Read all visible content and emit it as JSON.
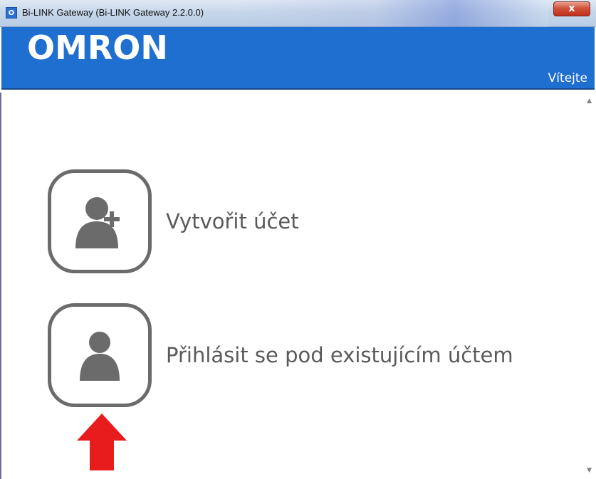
{
  "window": {
    "title": "Bi-LINK Gateway (Bi-LINK Gateway 2.2.0.0)",
    "close_label": "x"
  },
  "header": {
    "logo": "OMRON",
    "welcome": "Vítejte",
    "color": "#1e6fd0"
  },
  "options": {
    "create_account": "Vytvořit účet",
    "login_existing": "Přihlásit se pod existujícím účtem"
  },
  "icons": {
    "create": "add-user-icon",
    "login": "user-icon",
    "pointer": "red-arrow-up-icon"
  }
}
